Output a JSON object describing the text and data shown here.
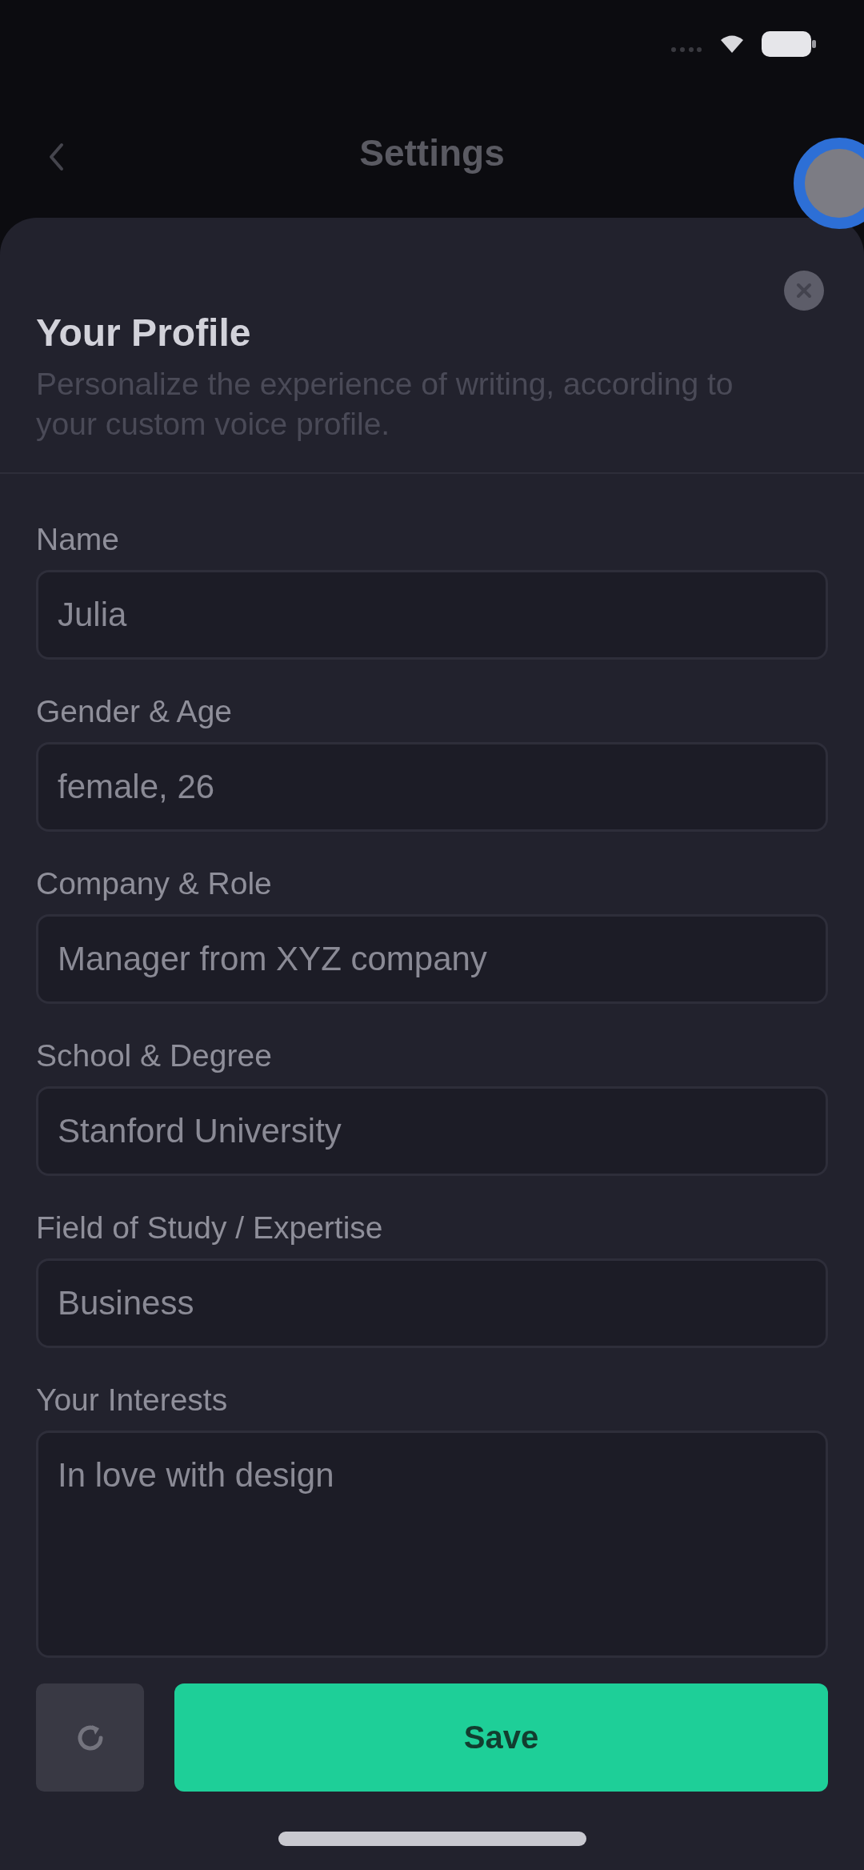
{
  "header": {
    "title": "Settings"
  },
  "profile": {
    "title": "Your Profile",
    "description": "Personalize the experience of writing, according to your custom voice profile."
  },
  "fields": [
    {
      "kind": "input",
      "label": "Name",
      "value": "Julia"
    },
    {
      "kind": "input",
      "label": "Gender & Age",
      "value": "female, 26"
    },
    {
      "kind": "input",
      "label": "Company & Role",
      "value": "Manager from XYZ company"
    },
    {
      "kind": "input",
      "label": "School & Degree",
      "value": "Stanford University"
    },
    {
      "kind": "input",
      "label": "Field of Study / Expertise",
      "value": "Business"
    },
    {
      "kind": "textarea",
      "label": "Your Interests",
      "value": "In love with design"
    }
  ],
  "actions": {
    "save": "Save"
  }
}
